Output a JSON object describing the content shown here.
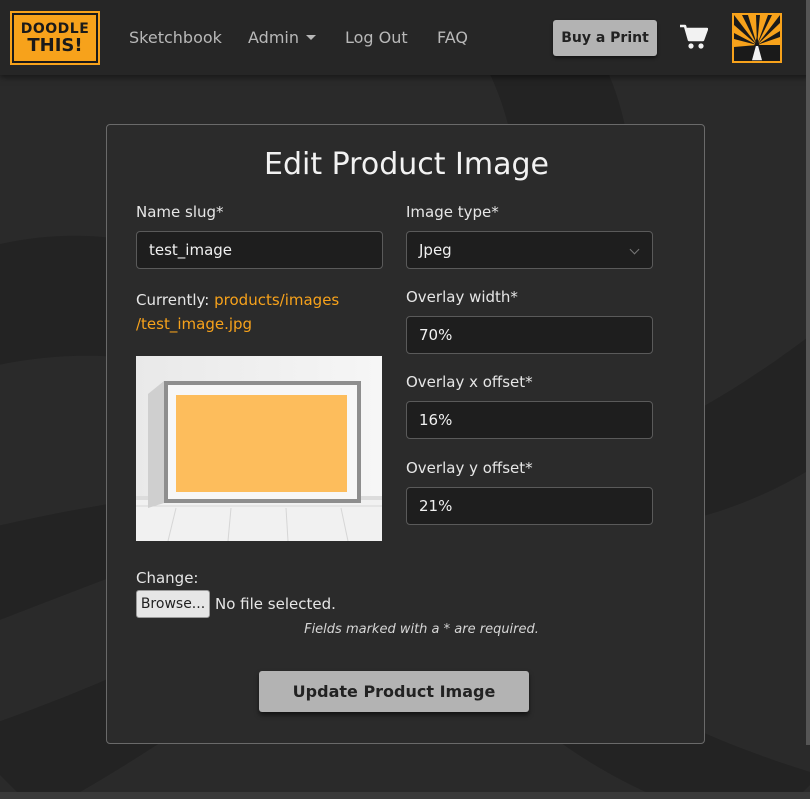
{
  "navbar": {
    "logo_line1": "DOODLE",
    "logo_line2": "THIS!",
    "links": {
      "sketchbook": "Sketchbook",
      "admin": "Admin",
      "logout": "Log Out",
      "faq": "FAQ"
    },
    "buy_print_label": "Buy a Print",
    "icons": {
      "cart": "cart-icon",
      "avatar": "avatar-icon",
      "admin_caret": "caret-down-icon"
    }
  },
  "form": {
    "title": "Edit Product Image",
    "name_slug": {
      "label": "Name slug*",
      "value": "test_image"
    },
    "image_type": {
      "label": "Image type*",
      "value": "Jpeg"
    },
    "current": {
      "prefix": "Currently:",
      "link_line1": "products/images",
      "link_line2": "/test_image.jpg"
    },
    "overlay_width": {
      "label": "Overlay width*",
      "value": "70%"
    },
    "overlay_x": {
      "label": "Overlay x offset*",
      "value": "16%"
    },
    "overlay_y": {
      "label": "Overlay y offset*",
      "value": "21%"
    },
    "change_label": "Change:",
    "browse_label": "Browse...",
    "no_file_label": "No file selected.",
    "required_note": "Fields marked with a * are required.",
    "submit_label": "Update Product Image"
  },
  "colors": {
    "accent": "#f7a21b",
    "background": "#2a2a2a",
    "navbar": "#262626",
    "button": "#b3b3b3",
    "overlay_fill": "#fdbd5c"
  }
}
